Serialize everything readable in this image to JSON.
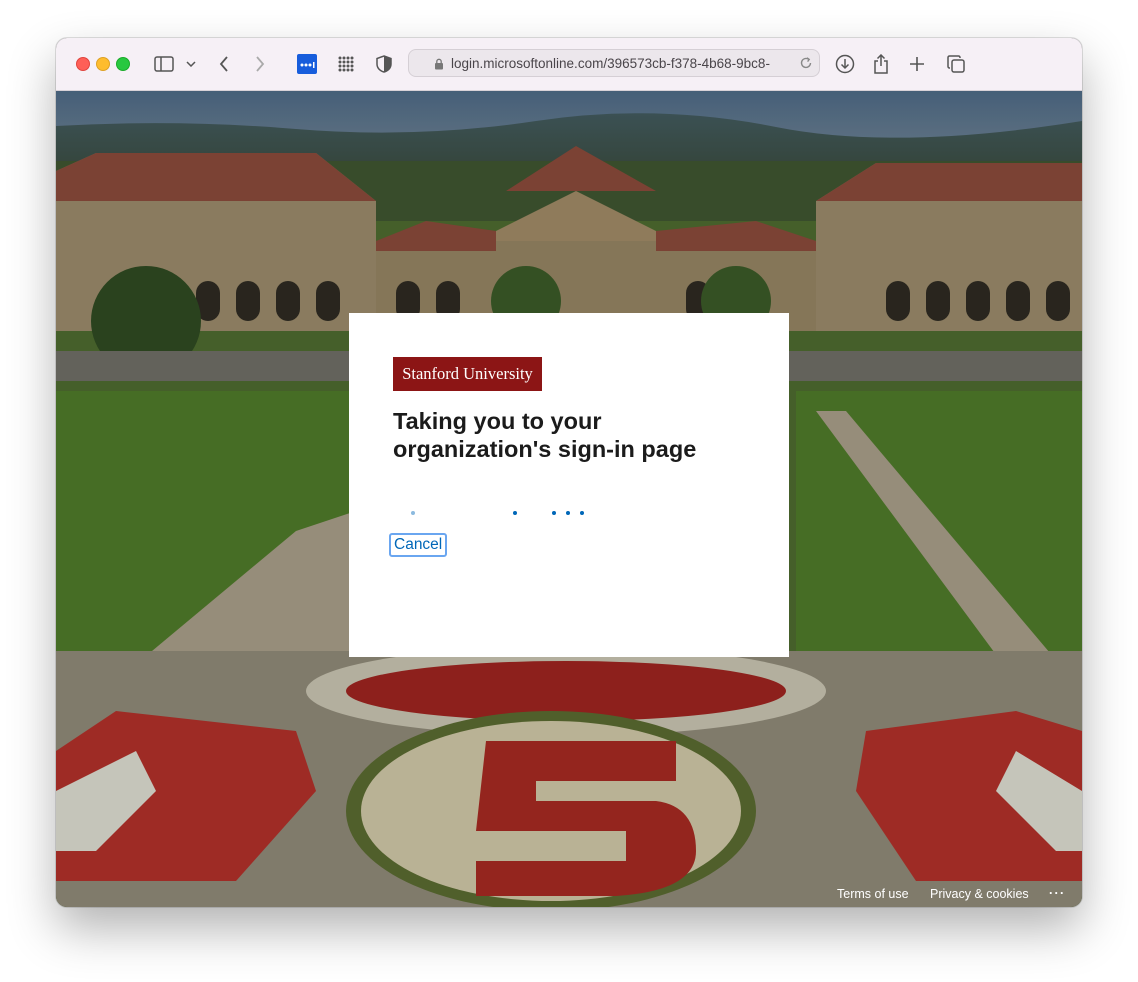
{
  "browser": {
    "url": "login.microsoftonline.com/396573cb-f378-4b68-9bc8-",
    "icons": [
      "sidebar-icon",
      "chevron-down-icon",
      "back-icon",
      "forward-icon",
      "password-manager-icon",
      "grid-icon",
      "shield-icon",
      "lock-icon",
      "reload-icon",
      "download-icon",
      "share-icon",
      "new-tab-icon",
      "tabs-icon"
    ]
  },
  "card": {
    "logo_text": "Stanford University",
    "title": "Taking you to your organization's sign-in page",
    "cancel_label": "Cancel"
  },
  "footer": {
    "terms": "Terms of use",
    "privacy": "Privacy & cookies",
    "more": "..."
  },
  "colors": {
    "stanford_cardinal": "#8c1515",
    "link_blue": "#0067b8"
  }
}
